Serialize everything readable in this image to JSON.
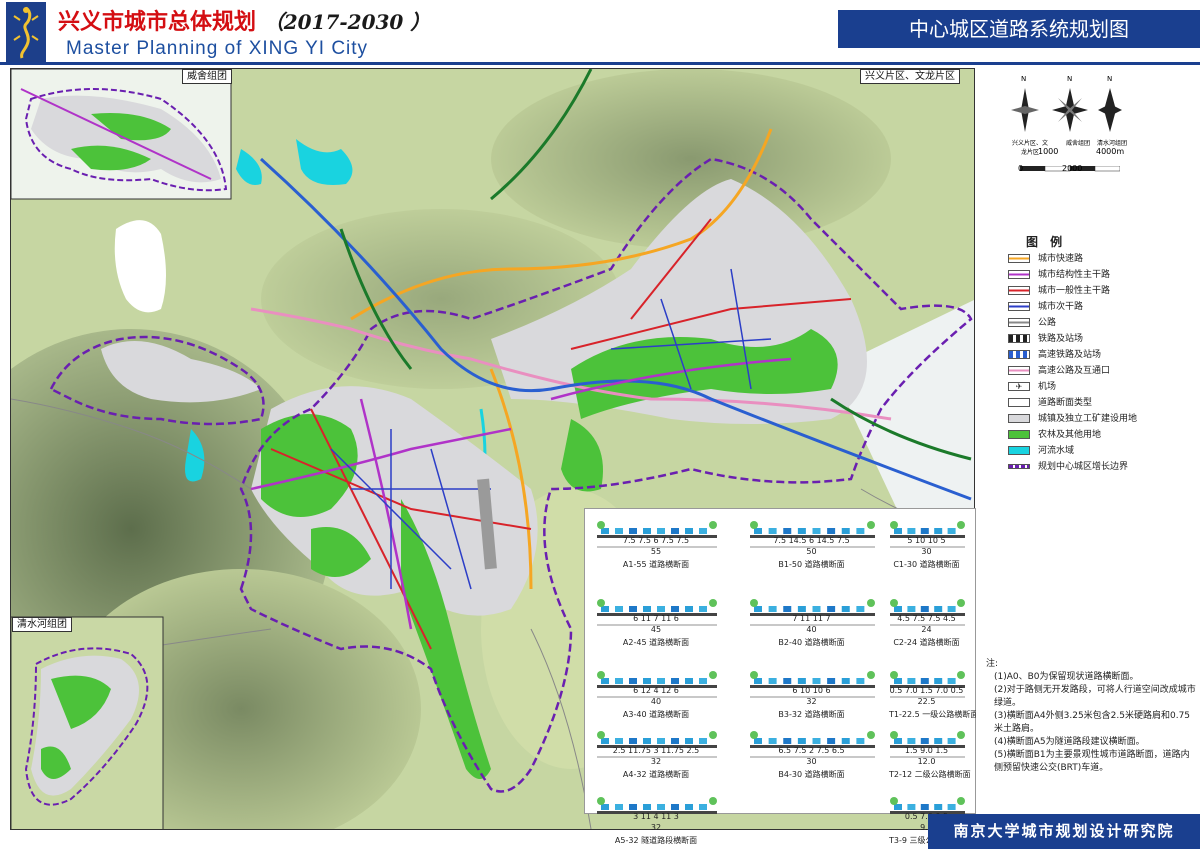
{
  "header": {
    "city": "兴义市",
    "title_rest": "城市总体规划",
    "years": "（2017-2030 ）",
    "english": "Master Planning of XING YI City",
    "map_title": "中心城区道路系统规划图"
  },
  "insets": {
    "weishe": "威舍组团",
    "qingshuihe": "清水河组团",
    "xingyi_wenlong": "兴义片区、文龙片区"
  },
  "compass": {
    "n_label": "N",
    "captions": [
      "兴义片区、文龙片区",
      "威舍组团",
      "清水河组团"
    ],
    "scale_top": [
      "1000",
      "4000m"
    ],
    "scale_bottom": [
      "0",
      "2000"
    ]
  },
  "legend": {
    "title": "图  例",
    "items": [
      {
        "label": "城市快速路",
        "icon": "line-orange",
        "color": "#f5a623"
      },
      {
        "label": "城市结构性主干路",
        "icon": "line-purple",
        "color": "#b033c8"
      },
      {
        "label": "城市一般性主干路",
        "icon": "line-red",
        "color": "#d8232a"
      },
      {
        "label": "城市次干路",
        "icon": "line-blue",
        "color": "#2c3ec7"
      },
      {
        "label": "公路",
        "icon": "line-gray",
        "color": "#888888"
      },
      {
        "label": "铁路及站场",
        "icon": "rail-black",
        "color": "#222222"
      },
      {
        "label": "高速铁路及站场",
        "icon": "rail-blue",
        "color": "#2a5fd0"
      },
      {
        "label": "高速公路及互通口",
        "icon": "line-pink",
        "color": "#e98fc0"
      },
      {
        "label": "机场",
        "icon": "airport-icon",
        "color": "#555555"
      },
      {
        "label": "道路断面类型",
        "icon": "section-tag-icon",
        "color": "#333333"
      },
      {
        "label": "城镇及独立工矿建设用地",
        "icon": "fill-gray",
        "color": "#d9d9dc"
      },
      {
        "label": "农林及其他用地",
        "icon": "fill-green",
        "color": "#4cc23a"
      },
      {
        "label": "河流水域",
        "icon": "fill-cyan",
        "color": "#19d3e0"
      },
      {
        "label": "规划中心城区增长边界",
        "icon": "dash-purple",
        "color": "#6a1fb0"
      }
    ]
  },
  "cross_sections": [
    {
      "code": "A1-55 道路横断面",
      "width": "55",
      "dims": "7.5  7.5  6   7.5  7.5"
    },
    {
      "code": "B1-50 道路横断面",
      "width": "50",
      "dims": "7.5  14.5  6  14.5  7.5"
    },
    {
      "code": "C1-30 道路横断面",
      "width": "30",
      "dims": "5  10  10  5"
    },
    {
      "code": "A2-45 道路横断面",
      "width": "45",
      "dims": "6  11  7  11  6"
    },
    {
      "code": "B2-40 道路横断面",
      "width": "40",
      "dims": "7  11  11  7"
    },
    {
      "code": "C2-24 道路横断面",
      "width": "24",
      "dims": "4.5  7.5  7.5  4.5"
    },
    {
      "code": "A3-40 道路横断面",
      "width": "40",
      "dims": "6  12  4  12  6"
    },
    {
      "code": "B3-32 道路横断面",
      "width": "32",
      "dims": "6  10  10  6"
    },
    {
      "code": "T1-22.5 一级公路横断面",
      "width": "22.5",
      "dims": "0.5  7.0  1.5  7.0  0.5"
    },
    {
      "code": "A4-32 道路横断面",
      "width": "32",
      "dims": "2.5  11.75  3  11.75  2.5"
    },
    {
      "code": "B4-30 道路横断面",
      "width": "30",
      "dims": "6.5  7.5  2  7.5  6.5"
    },
    {
      "code": "T2-12 二级公路横断面",
      "width": "12.0",
      "dims": "1.5  9.0  1.5"
    },
    {
      "code": "A5-32 隧道路段横断面",
      "width": "32",
      "dims": "3  11  4  11  3"
    },
    {
      "code": "T3-9 三级公路横断面",
      "width": "9.0",
      "dims": "0.5  7.0  0.5"
    }
  ],
  "notes": {
    "head": "注:",
    "lines": [
      "(1)A0、B0为保留现状道路横断面。",
      "(2)对于路侧无开发路段，可将人行道空间改成城市绿道。",
      "(3)横断面A4外侧3.25米包含2.5米硬路肩和0.75米土路肩。",
      "(4)横断面A5为隧道路段建议横断面。",
      "(5)横断面B1为主要景观性城市道路断面，道路内侧预留快速公交(BRT)车道。"
    ]
  },
  "footer": {
    "institute": "南京大学城市规划设计研究院"
  },
  "colors": {
    "brand_blue": "#1a3f8f",
    "title_red": "#d40e12",
    "urban_gray": "#d9d9dc",
    "green": "#4cc23a",
    "water": "#19d3e0"
  }
}
